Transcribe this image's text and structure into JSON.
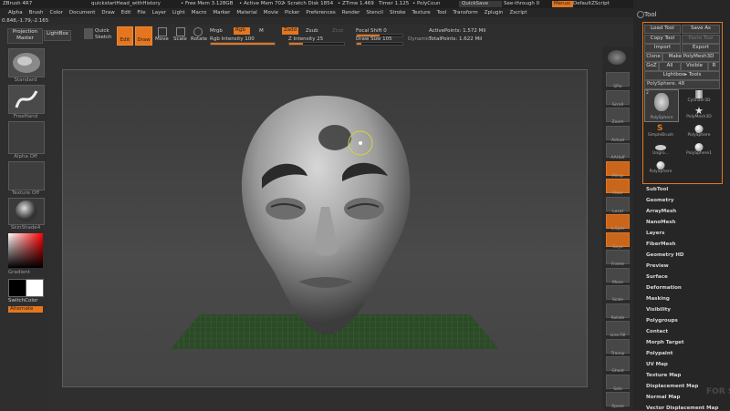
{
  "title_bar": {
    "app": "ZBrush 4R7",
    "document": "quickstartHead_withHistory",
    "free_mem": "• Free Mem 3.128GB",
    "active_mem": "• Active Mem 702",
    "scratch": "• Scratch Disk 1854",
    "ztime": "• ZTime 1.469",
    "timer": "Timer 1.125",
    "polycount": "• PolyCoun",
    "quicksave": "QuickSave",
    "seethrough": "See-through 0",
    "menus": "Menus",
    "default_script": "DefaultZScript"
  },
  "menu_bar": [
    "Alpha",
    "Brush",
    "Color",
    "Document",
    "Draw",
    "Edit",
    "File",
    "Layer",
    "Light",
    "Macro",
    "Marker",
    "Material",
    "Movie",
    "Picker",
    "Preferences",
    "Render",
    "Stencil",
    "Stroke",
    "Texture",
    "Tool",
    "Transform",
    "Zplugin",
    "Zscript"
  ],
  "coords": "0.848,-1.79,-2.165",
  "shelf": {
    "projection_master": "Projection Master",
    "lightbox": "LightBox",
    "quick_sketch": "Quick Sketch",
    "edit": "Edit",
    "draw": "Draw",
    "move": "Move",
    "scale": "Scale",
    "rotate": "Rotate",
    "mrgb": "Mrgb",
    "rgb": "Rgb",
    "m": "M",
    "rgb_intensity": "Rgb Intensity 100",
    "zadd": "Zadd",
    "zsub": "Zsub",
    "zcut": "Zcut",
    "z_intensity": "Z Intensity 25",
    "focal_shift": "Focal Shift 0",
    "draw_size": "Draw Size 105",
    "dynamic": "Dynamic",
    "active_points": "ActivePoints: 1.572 Mil",
    "total_points": "TotalPoints: 1.622 Mil",
    "rgb_intensity_value": 100,
    "z_intensity_value": 25,
    "focal_shift_value": 0,
    "draw_size_value": 105
  },
  "left_tray": {
    "brush_label": "Standard",
    "stroke_label": "FreeHand",
    "alpha_label": "Alpha Off",
    "texture_label": "Texture Off",
    "material_label": "SkinShade4",
    "gradient_label": "Gradient",
    "switch_color_label": "SwitchColor",
    "alternate_label": "Alternate"
  },
  "right_strip": [
    "SPix",
    "Scroll",
    "Zoom",
    "Actual",
    "AAHalf",
    "Persp",
    "Floor",
    "Local",
    "L.Sym",
    "Gxyz",
    "Frame",
    "Move",
    "Scale",
    "Rotate",
    "Line Fill",
    "Transp",
    "Ghost",
    "Solo",
    "Xpose"
  ],
  "tool_panel": {
    "header": "Tool",
    "load_tool": "Load Tool",
    "save_as": "Save As",
    "copy_tool": "Copy Tool",
    "paste_tool": "Paste Tool",
    "import": "Import",
    "export": "Export",
    "clone": "Clone",
    "make_polymesh": "Make PolyMesh3D",
    "goz": "GoZ",
    "all": "All",
    "visible": "Visible",
    "r": "R",
    "lightbox_tools": "Lightbox▸ Tools",
    "polysphere_slider": "PolySphere. 48",
    "thumbs": [
      {
        "label": "PolySphere",
        "count": "2"
      },
      {
        "label": "Cylinder3D"
      },
      {
        "label": "PolyMesh3D"
      },
      {
        "label": "SimpleBrush"
      },
      {
        "label": "PolySphere"
      },
      {
        "label": "Ungro..."
      },
      {
        "label": "PolySphere1"
      },
      {
        "label": "PolySphere"
      }
    ],
    "sections": [
      "SubTool",
      "Geometry",
      "ArrayMesh",
      "NanoMesh",
      "Layers",
      "FiberMesh",
      "Geometry HD",
      "Preview",
      "Surface",
      "Deformation",
      "Masking",
      "Visibility",
      "Polygroups",
      "Contact",
      "Morph Target",
      "Polypaint",
      "UV Map",
      "Texture Map",
      "Displacement Map",
      "Normal Map",
      "Vector Displacement Map"
    ]
  },
  "colors": {
    "accent": "#e3761f",
    "panel": "#262626",
    "canvas": "#404040"
  },
  "watermark": "FOR SHOP"
}
